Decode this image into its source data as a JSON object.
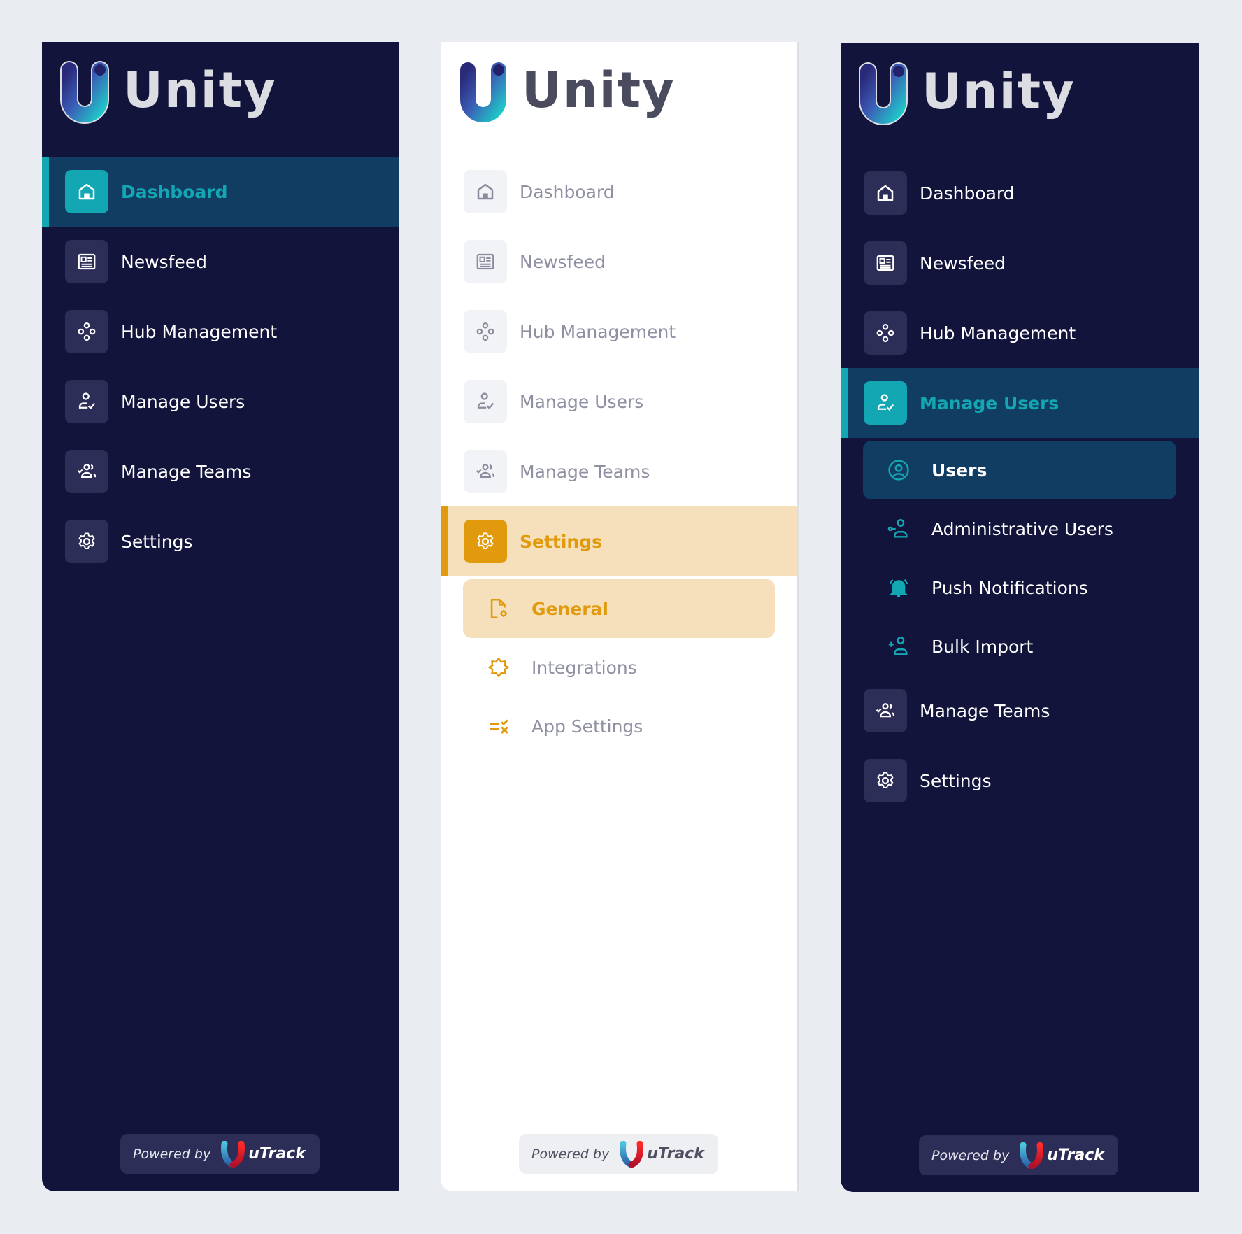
{
  "brand": {
    "name": "Unity"
  },
  "footer": {
    "powered_by": "Powered by",
    "vendor": "uTrack"
  },
  "colors": {
    "dark_bg": "#12143b",
    "teal_accent": "#13a6b3",
    "teal_active_bg": "#123d62",
    "gold_accent": "#e09a0c",
    "gold_active_bg": "#f5e0bb",
    "page_bg": "#e9edf1"
  },
  "panels": [
    {
      "theme": "dark",
      "active": "Dashboard",
      "nav": [
        {
          "label": "Dashboard",
          "icon": "home-icon"
        },
        {
          "label": "Newsfeed",
          "icon": "newsfeed-icon"
        },
        {
          "label": "Hub Management",
          "icon": "hub-icon"
        },
        {
          "label": "Manage Users",
          "icon": "user-check-icon"
        },
        {
          "label": "Manage Teams",
          "icon": "team-icon"
        },
        {
          "label": "Settings",
          "icon": "gear-icon"
        }
      ]
    },
    {
      "theme": "light",
      "active": "Settings",
      "nav": [
        {
          "label": "Dashboard",
          "icon": "home-icon"
        },
        {
          "label": "Newsfeed",
          "icon": "newsfeed-icon"
        },
        {
          "label": "Hub Management",
          "icon": "hub-icon"
        },
        {
          "label": "Manage Users",
          "icon": "user-check-icon"
        },
        {
          "label": "Manage Teams",
          "icon": "team-icon"
        },
        {
          "label": "Settings",
          "icon": "gear-icon"
        }
      ],
      "sub": [
        {
          "label": "General",
          "icon": "file-settings-icon",
          "active": true
        },
        {
          "label": "Integrations",
          "icon": "puzzle-icon",
          "active": false
        },
        {
          "label": "App Settings",
          "icon": "list-check-icon",
          "active": false
        }
      ]
    },
    {
      "theme": "dark",
      "active": "Manage Users",
      "nav": [
        {
          "label": "Dashboard",
          "icon": "home-icon"
        },
        {
          "label": "Newsfeed",
          "icon": "newsfeed-icon"
        },
        {
          "label": "Hub Management",
          "icon": "hub-icon"
        },
        {
          "label": "Manage Users",
          "icon": "user-check-icon"
        },
        {
          "label": "Manage Teams",
          "icon": "team-icon"
        },
        {
          "label": "Settings",
          "icon": "gear-icon"
        }
      ],
      "sub": [
        {
          "label": "Users",
          "icon": "user-circle-icon",
          "active": true
        },
        {
          "label": "Administrative Users",
          "icon": "admin-user-icon",
          "active": false
        },
        {
          "label": "Push Notifications",
          "icon": "bell-icon",
          "active": false
        },
        {
          "label": "Bulk Import",
          "icon": "user-plus-icon",
          "active": false
        }
      ]
    }
  ]
}
